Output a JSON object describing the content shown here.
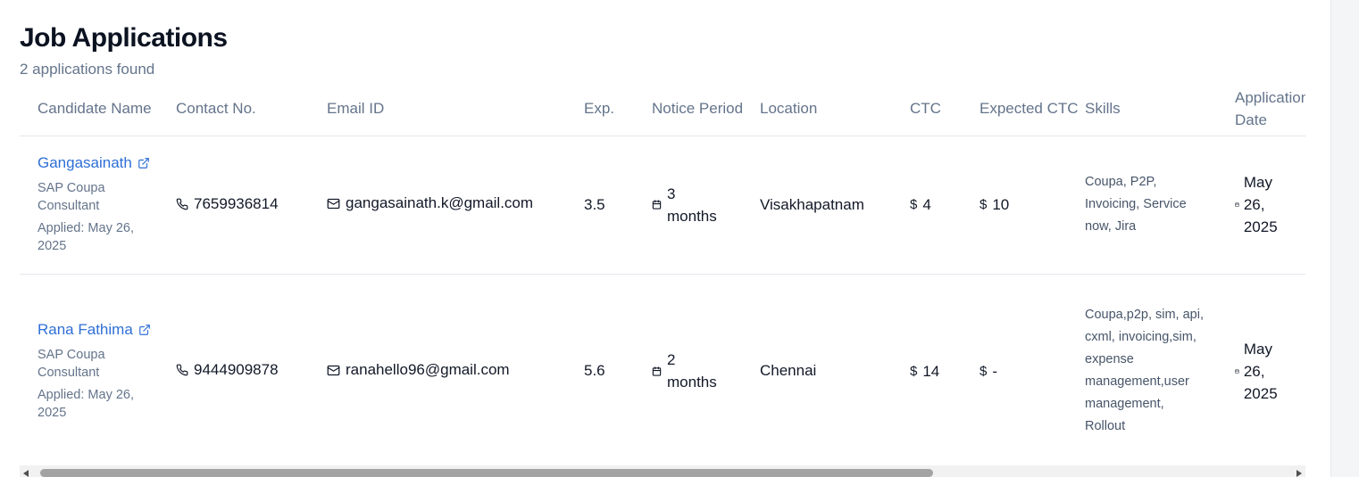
{
  "header": {
    "title": "Job Applications",
    "subtitle": "2 applications found"
  },
  "columns": [
    "Candidate Name",
    "Contact No.",
    "Email ID",
    "Exp.",
    "Notice Period",
    "Location",
    "CTC",
    "Expected CTC",
    "Skills",
    "Application Date"
  ],
  "rows": [
    {
      "name": "Gangasainath",
      "role": "SAP Coupa Consultant",
      "applied": "Applied: May 26, 2025",
      "phone": "7659936814",
      "email": "gangasainath.k@gmail.com",
      "exp": "3.5",
      "notice": "3 months",
      "location": "Visakhapatnam",
      "ctc": "4",
      "expected_ctc": "10",
      "skills": "Coupa, P2P, Invoicing, Service now, Jira",
      "date": "May 26, 2025"
    },
    {
      "name": "Rana Fathima",
      "role": "SAP Coupa Consultant",
      "applied": "Applied: May 26, 2025",
      "phone": "9444909878",
      "email": "ranahello96@gmail.com",
      "exp": "5.6",
      "notice": "2 months",
      "location": "Chennai",
      "ctc": "14",
      "expected_ctc": "-",
      "skills": "Coupa,p2p, sim, api, cxml, invoicing,sim, expense management,user management, Rollout",
      "date": "May 26, 2025"
    }
  ],
  "currency_symbol": "$",
  "colors": {
    "link": "#2f6fd6",
    "muted": "#64748b",
    "border": "#e5e7eb"
  }
}
